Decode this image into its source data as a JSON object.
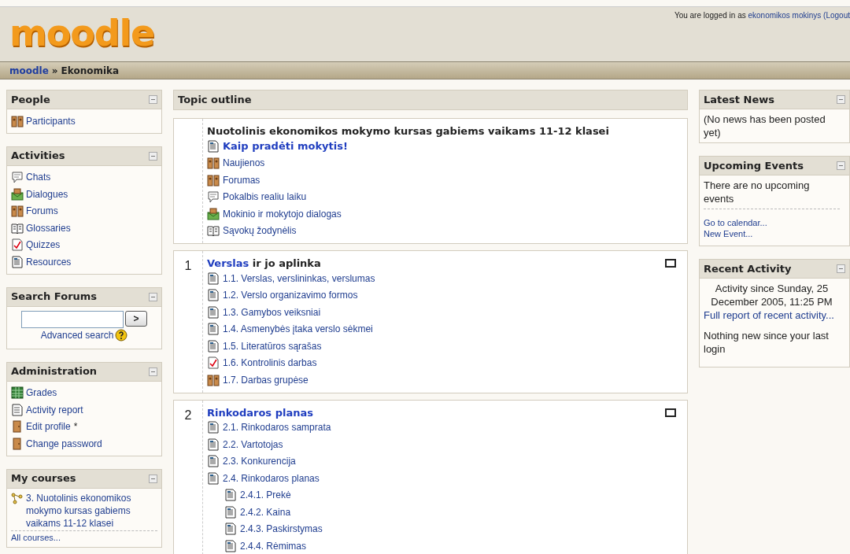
{
  "header": {
    "logo": "moodle",
    "login_prefix": "You are logged in as ",
    "user": "ekonomikos mokinys",
    "logout": "(Logout"
  },
  "breadcrumb": {
    "home": "moodle",
    "separator": "»",
    "current": "Ekonomika"
  },
  "left_blocks": [
    {
      "title": "People",
      "kind": "list",
      "items": [
        {
          "label": "Participants",
          "kind": "people"
        }
      ]
    },
    {
      "title": "Activities",
      "kind": "list",
      "items": [
        {
          "label": "Chats",
          "kind": "chat"
        },
        {
          "label": "Dialogues",
          "kind": "dialogue"
        },
        {
          "label": "Forums",
          "kind": "people"
        },
        {
          "label": "Glossaries",
          "kind": "glossary"
        },
        {
          "label": "Quizzes",
          "kind": "quiz"
        },
        {
          "label": "Resources",
          "kind": "resource"
        }
      ]
    },
    {
      "title": "Search Forums",
      "kind": "search",
      "button": ">",
      "link": "Advanced search"
    },
    {
      "title": "Administration",
      "kind": "list",
      "items": [
        {
          "label": "Grades",
          "kind": "grades"
        },
        {
          "label": "Activity report",
          "kind": "report"
        },
        {
          "label": "Edit profile",
          "suffix": "*",
          "kind": "profile"
        },
        {
          "label": "Change password",
          "kind": "profile"
        }
      ]
    },
    {
      "title": "My courses",
      "kind": "courses",
      "items": [
        {
          "label": "3. Nuotolinis ekonomikos mokymo kursas gabiems vaikams 11-12 klasei",
          "kind": "course"
        }
      ],
      "footer": "All courses..."
    }
  ],
  "topic_outline": {
    "title": "Topic outline",
    "sections": [
      {
        "heading": "Nuotolinis ekonomikos mokymo kursas gabiems vaikams 11-12 klasei",
        "highlight_box": false,
        "items": [
          {
            "label": "Kaip pradėti mokytis!",
            "kind": "resource",
            "bold": true
          },
          {
            "label": "Naujienos",
            "kind": "people",
            "bold": false
          },
          {
            "label": "Forumas",
            "kind": "people",
            "bold": false
          },
          {
            "label": "Pokalbis realiu laiku",
            "kind": "chat",
            "bold": false
          },
          {
            "label": "Mokinio ir mokytojo dialogas",
            "kind": "dialogue",
            "bold": false
          },
          {
            "label": "Sąvokų žodynėlis",
            "kind": "glossary",
            "bold": false
          }
        ]
      },
      {
        "number": "1",
        "heading_link": "Verslas",
        "heading": " ir jo aplinka",
        "highlight_box": true,
        "items": [
          {
            "label": "1.1. Verslas, verslininkas, verslumas",
            "kind": "resource",
            "bold": false
          },
          {
            "label": "1.2. Verslo organizavimo formos",
            "kind": "resource",
            "bold": false
          },
          {
            "label": "1.3. Gamybos veiksniai",
            "kind": "resource",
            "bold": false
          },
          {
            "label": "1.4. Asmenybės įtaka verslo sėkmei",
            "kind": "resource",
            "bold": false
          },
          {
            "label": "1.5. Literatūros sąrašas",
            "kind": "resource",
            "bold": false
          },
          {
            "label": "1.6. Kontrolinis darbas",
            "kind": "quiz",
            "bold": false
          },
          {
            "label": "1.7. Darbas grupėse",
            "kind": "people",
            "bold": false
          }
        ]
      },
      {
        "number": "2",
        "heading_link": "Rinkodaros planas",
        "highlight_box": true,
        "items": [
          {
            "label": "2.1. Rinkodaros samprata",
            "kind": "resource",
            "bold": false
          },
          {
            "label": "2.2. Vartotojas",
            "kind": "resource",
            "bold": false
          },
          {
            "label": "2.3. Konkurencija",
            "kind": "resource",
            "bold": false
          },
          {
            "label": "2.4. Rinkodaros planas",
            "kind": "resource",
            "bold": false,
            "children": [
              {
                "label": "2.4.1. Prekė",
                "kind": "resource",
                "bold": false
              },
              {
                "label": "2.4.2. Kaina",
                "kind": "resource",
                "bold": false
              },
              {
                "label": "2.4.3. Paskirstymas",
                "kind": "resource",
                "bold": false
              },
              {
                "label": "2.4.4. Rėmimas",
                "kind": "resource",
                "bold": false
              }
            ]
          }
        ]
      }
    ]
  },
  "right_blocks": [
    {
      "title": "Latest News",
      "kind": "text",
      "text": "(No news has been posted yet)"
    },
    {
      "title": "Upcoming Events",
      "kind": "events",
      "text": "There are no upcoming events",
      "links": [
        "Go to calendar...",
        "New Event..."
      ]
    },
    {
      "title": "Recent Activity",
      "kind": "activity",
      "since": "Activity since Sunday, 25 December 2005, 11:25 PM",
      "link": "Full report of recent activity...",
      "text": "Nothing new since your last login"
    }
  ]
}
